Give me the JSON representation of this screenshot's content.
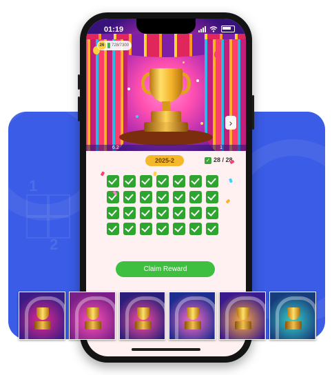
{
  "status_bar": {
    "time": "01:19"
  },
  "hero": {
    "level": "26",
    "progress": "728/7300",
    "strip_left": "6.2",
    "strip_right": "1",
    "next_icon": "›"
  },
  "toolbar": {
    "year": "2025-2",
    "progress": "28 / 28"
  },
  "grid": {
    "rows": 4,
    "cols": 7,
    "checked": 28
  },
  "claim_button": {
    "label": "Claim Reward"
  },
  "thumbnails": [
    {
      "name": "carnival-balloons",
      "colors": [
        "#3b1b86",
        "#e42a8e"
      ]
    },
    {
      "name": "pink-curtains",
      "colors": [
        "#7a1f88",
        "#ff52b4"
      ]
    },
    {
      "name": "circus-stage",
      "colors": [
        "#2b1e7a",
        "#ff4e9e"
      ]
    },
    {
      "name": "night-arch",
      "colors": [
        "#1d2c8f",
        "#ff6ec7"
      ]
    },
    {
      "name": "spotlight-show",
      "colors": [
        "#3a1a8e",
        "#ffae3c"
      ]
    },
    {
      "name": "rainbow-arch",
      "colors": [
        "#173c7c",
        "#38d0c6"
      ]
    }
  ],
  "colors": {
    "card_bg": "#3a5ce6",
    "check_green": "#2ea52e",
    "button_green": "#3fbf3f",
    "year_pill": "#f5b82a",
    "screen_bg": "#fff0f1"
  }
}
